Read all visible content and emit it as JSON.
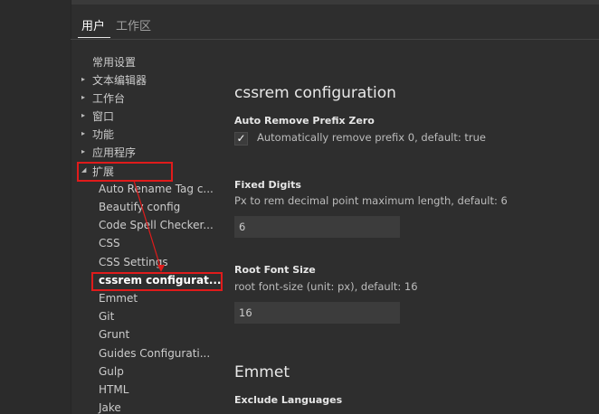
{
  "tabs": [
    {
      "label": "用户",
      "active": true
    },
    {
      "label": "工作区",
      "active": false
    }
  ],
  "tree": {
    "items": [
      {
        "label": "常用设置",
        "expandable": false
      },
      {
        "label": "文本编辑器",
        "expandable": true,
        "chevron": "▸"
      },
      {
        "label": "工作台",
        "expandable": true,
        "chevron": "▸"
      },
      {
        "label": "窗口",
        "expandable": true,
        "chevron": "▸"
      },
      {
        "label": "功能",
        "expandable": true,
        "chevron": "▸"
      },
      {
        "label": "应用程序",
        "expandable": true,
        "chevron": "▸"
      },
      {
        "label": "扩展",
        "expandable": true,
        "expanded": true,
        "chevron": "◢"
      }
    ],
    "extensions": [
      "Auto Rename Tag c...",
      "Beautify config",
      "Code Spell Checker...",
      "CSS",
      "CSS Settings",
      "cssrem configurat...",
      "Emmet",
      "Git",
      "Grunt",
      "Guides Configurati...",
      "Gulp",
      "HTML",
      "Jake"
    ],
    "selected_extension": "cssrem configurat..."
  },
  "main": {
    "section_title": "cssrem configuration",
    "settings": {
      "auto_remove": {
        "title": "Auto Remove Prefix Zero",
        "checkbox_label": "Automatically remove prefix 0, default: true",
        "checked": true,
        "check_glyph": "✓"
      },
      "fixed_digits": {
        "title": "Fixed Digits",
        "description": "Px to rem decimal point maximum length, default: 6",
        "value": "6"
      },
      "root_font_size": {
        "title": "Root Font Size",
        "description": "root font-size (unit: px), default: 16",
        "value": "16"
      }
    },
    "emmet": {
      "section_title": "Emmet",
      "exclude_languages_title": "Exclude Languages"
    }
  },
  "colors": {
    "background": "#2e2e2e",
    "annotation": "#e01b1b",
    "input_bg": "#3c3c3c",
    "text": "#cccccc"
  },
  "icons": {
    "collapsed": "chevron-right-icon",
    "expanded": "chevron-down-icon",
    "check": "checkmark-icon"
  }
}
